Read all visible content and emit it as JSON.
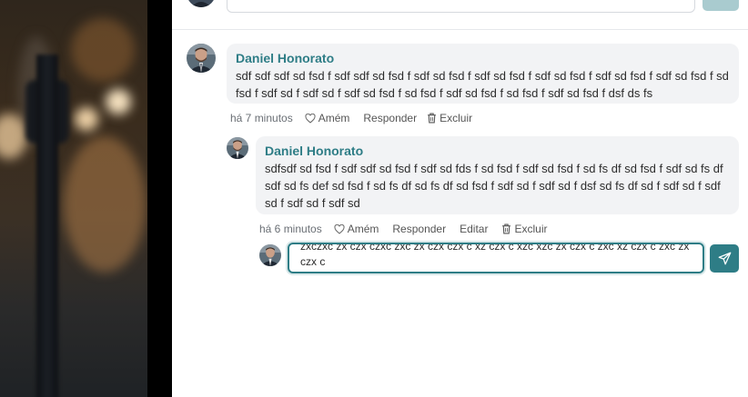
{
  "comments": [
    {
      "author": "Daniel Honorato",
      "text": "sdf sdf sdf sd fsd f sdf sdf sd fsd f sdf sd fsd f sdf sd fsd f sdf sd fsd f sdf sd fsd f sdf sd fsd f sd fsd f sdf sd f sdf sd f sdf sd fsd f sd fsd f sdf sd fsd f sd fsd f sdf sd fsd f dsf ds fs",
      "time": "há 7 minutos",
      "actions": {
        "amen": "Amém",
        "reply": "Responder",
        "delete": "Excluir"
      },
      "reply": {
        "author": "Daniel Honorato",
        "text": "sdfsdf sd fsd f sdf sdf sd fsd f sdf sd fds f sd fsd f sdf sd fsd f sd fs df sd fsd f sdf sd fs df sdf sd fs def sd fsd f sd fs df sd fs df sd fsd f sdf sd f sdf sd f dsf sd fs df sd f sdf sd f sdf sd f sdf sd f sdf sd",
        "time": "há 6 minutos",
        "actions": {
          "amen": "Amém",
          "reply": "Responder",
          "edit": "Editar",
          "delete": "Excluir"
        }
      }
    }
  ],
  "reply_input": {
    "value": "zxczxc zx czx czxc zxc zx czx czx c xz czx c xzc xzc zx czx c zxc xz czx c zxc zx czx c"
  },
  "colors": {
    "accent": "#2e7d86",
    "bubble": "#f2f3f5",
    "name": "#2e7d86"
  },
  "icons": {
    "amen": "heart-icon",
    "delete": "trash-icon",
    "send": "send-icon"
  }
}
